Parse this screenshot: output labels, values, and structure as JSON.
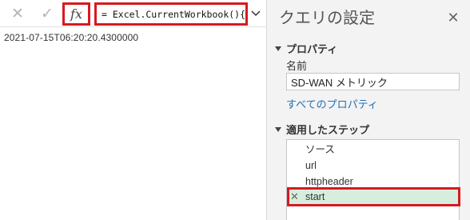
{
  "formula_bar": {
    "cancel_icon": "✕",
    "commit_icon": "✓",
    "fx_label": "fx",
    "formula": "= Excel.CurrentWorkbook(){",
    "expand_icon": "chevron-down-icon"
  },
  "result": {
    "value": "2021-07-15T06:20:20.4300000"
  },
  "query_settings": {
    "title": "クエリの設定",
    "close_icon": "✕",
    "properties": {
      "heading": "プロパティ",
      "name_label": "名前",
      "name_value": "SD-WAN メトリック",
      "all_properties_link": "すべてのプロパティ"
    },
    "applied_steps": {
      "heading": "適用したステップ",
      "steps": [
        {
          "label": "ソース"
        },
        {
          "label": "url"
        },
        {
          "label": "httpheader"
        },
        {
          "label": "start"
        }
      ],
      "delete_icon": "✕"
    }
  }
}
